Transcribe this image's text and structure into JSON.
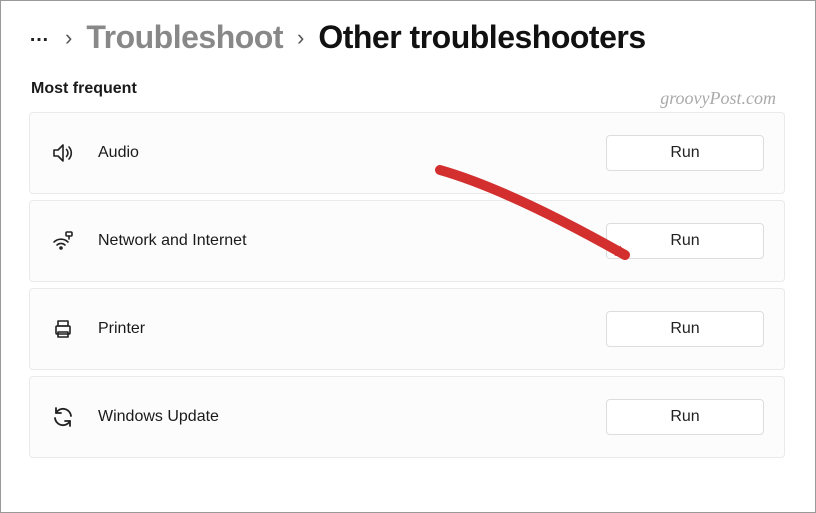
{
  "breadcrumb": {
    "ellipsis": "…",
    "crumb1": "Troubleshoot",
    "crumb2": "Other troubleshooters"
  },
  "section_title": "Most frequent",
  "watermark": "groovyPost.com",
  "items": [
    {
      "label": "Audio",
      "run": "Run"
    },
    {
      "label": "Network and Internet",
      "run": "Run"
    },
    {
      "label": "Printer",
      "run": "Run"
    },
    {
      "label": "Windows Update",
      "run": "Run"
    }
  ],
  "annotation": {
    "arrow_color": "#d32f2f"
  }
}
